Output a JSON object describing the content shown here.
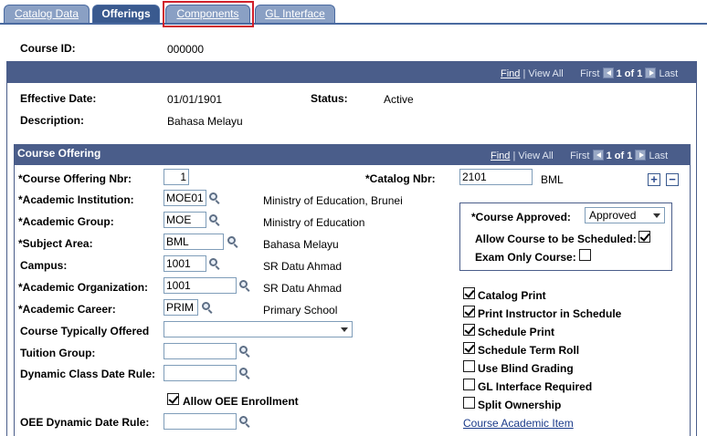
{
  "tabs": [
    {
      "label": "Catalog Data",
      "active": false
    },
    {
      "label": "Offerings",
      "active": true
    },
    {
      "label": "Components",
      "active": false
    },
    {
      "label": "GL Interface",
      "active": false
    }
  ],
  "course": {
    "id_label": "Course ID:",
    "id_value": "000000"
  },
  "outer_nav": {
    "find": "Find",
    "view_all": "View All",
    "first": "First",
    "count": "1 of 1",
    "last": "Last"
  },
  "effective": {
    "date_label": "Effective Date:",
    "date_value": "01/01/1901",
    "status_label": "Status:",
    "status_value": "Active",
    "desc_label": "Description:",
    "desc_value": "Bahasa Melayu"
  },
  "offering": {
    "title": "Course Offering",
    "nav": {
      "find": "Find",
      "view_all": "View All",
      "first": "First",
      "count": "1 of 1",
      "last": "Last"
    },
    "nbr_label": "*Course Offering Nbr:",
    "nbr_value": "1",
    "catalog_label": "*Catalog Nbr:",
    "catalog_value": "2101",
    "catalog_desc": "BML",
    "institution_label": "*Academic Institution:",
    "institution_value": "MOE01",
    "institution_desc": "Ministry of Education, Brunei",
    "group_label": "*Academic Group:",
    "group_value": "MOE",
    "group_desc": "Ministry of Education",
    "subject_label": "*Subject Area:",
    "subject_value": "BML",
    "subject_desc": "Bahasa Melayu",
    "campus_label": "Campus:",
    "campus_value": "1001",
    "campus_desc": "SR Datu Ahmad",
    "org_label": "*Academic Organization:",
    "org_value": "1001",
    "org_desc": "SR Datu Ahmad",
    "career_label": "*Academic Career:",
    "career_value": "PRIM",
    "career_desc": "Primary School",
    "typically_label": "Course Typically Offered",
    "typically_value": "",
    "tuition_label": "Tuition Group:",
    "tuition_value": "",
    "dynamic_label": "Dynamic Class Date Rule:",
    "dynamic_value": "",
    "oee_enroll_label": "Allow OEE Enrollment",
    "oee_rule_label": "OEE Dynamic Date Rule:",
    "oee_rule_value": "",
    "approved_label": "*Course Approved:",
    "approved_value": "Approved",
    "allow_sched_label": "Allow Course to be Scheduled:",
    "exam_only_label": "Exam Only Course:",
    "checks": [
      {
        "label": "Catalog Print",
        "checked": true
      },
      {
        "label": "Print Instructor in Schedule",
        "checked": true
      },
      {
        "label": "Schedule Print",
        "checked": true
      },
      {
        "label": "Schedule Term Roll",
        "checked": true
      },
      {
        "label": "Use Blind Grading",
        "checked": false
      },
      {
        "label": "GL Interface Required",
        "checked": false
      },
      {
        "label": "Split Ownership",
        "checked": false
      }
    ],
    "academic_item_link": "Course Academic Item",
    "add_symbol": "+",
    "remove_symbol": "−"
  },
  "colors": {
    "header_bar": "#4a5d8a",
    "tab_active": "#3a5a8f",
    "tab_inactive": "#8aa0c4",
    "highlight": "#d0202a",
    "link": "#1a3a8a"
  }
}
